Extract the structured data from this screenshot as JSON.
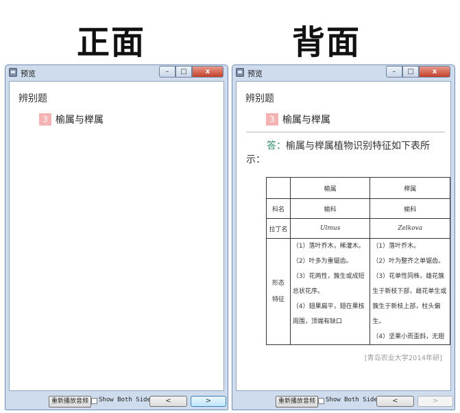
{
  "labels": {
    "front": "正面",
    "back": "背面"
  },
  "window": {
    "title": "预览",
    "minimize": "–",
    "maximize": "□",
    "close": "x"
  },
  "card": {
    "section": "辨别题",
    "question_number": "3",
    "question_text": "榆属与榉属"
  },
  "answer": {
    "label": "答：",
    "text": "榆属与榉属植物识别特征如下表所示："
  },
  "table": {
    "headers": [
      "",
      "榆属",
      "榉属"
    ],
    "rows": [
      [
        "科名",
        "榆科",
        "榆科"
      ],
      [
        "拉丁名",
        "Ulmus",
        "Zelkova"
      ]
    ],
    "morph_label_1": "形态",
    "morph_label_2": "特征",
    "elm_traits": [
      "（1）落叶乔木，稀灌木。",
      "（2）叶多为重锯齿。",
      "（3）花两性，簇生或成短总状花序。",
      "（4）翅果扁平，翅在果核周围，顶端有缺口"
    ],
    "zelkova_traits": [
      "（1）落叶乔木。",
      "（2）叶为整齐之单锯齿。",
      "（3）花单性同株，雄花簇生于新枝下部，雌花单生或簇生于新枝上部，柱头偏生。",
      "（4）坚果小而歪斜，无翅"
    ]
  },
  "citation": "[青岛农业大学2014年研]",
  "bottom": {
    "replay": "重新播放音频",
    "show_both": "Show Both Sides",
    "prev": "<",
    "next": ">"
  }
}
